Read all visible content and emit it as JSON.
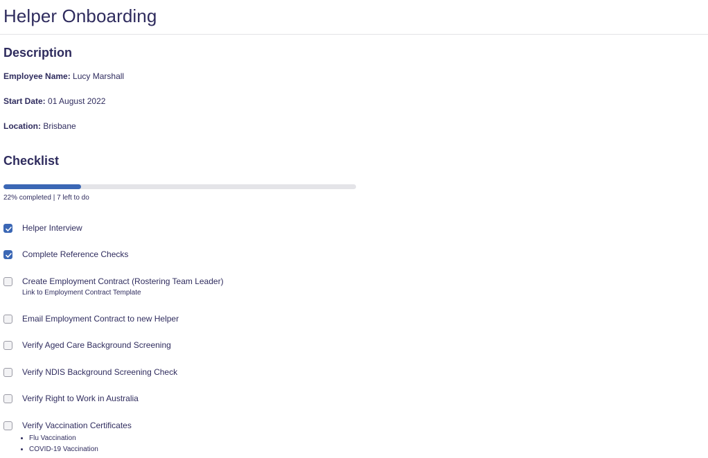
{
  "header": {
    "title": "Helper Onboarding"
  },
  "description": {
    "title": "Description",
    "fields": [
      {
        "label": "Employee Name:",
        "value": "Lucy Marshall"
      },
      {
        "label": "Start Date:",
        "value": "01 August 2022"
      },
      {
        "label": "Location:",
        "value": "Brisbane"
      }
    ]
  },
  "checklist": {
    "title": "Checklist",
    "progress_fraction": 0.22,
    "progress_text": "22% completed | 7 left to do",
    "accent_color": "#3b67b5",
    "items": [
      {
        "label": "Helper Interview",
        "checked": true
      },
      {
        "label": "Complete Reference Checks",
        "checked": true
      },
      {
        "label": "Create Employment Contract (Rostering Team Leader)",
        "checked": false,
        "note": "Link to Employment Contract Template"
      },
      {
        "label": "Email Employment Contract to new Helper",
        "checked": false
      },
      {
        "label": "Verify Aged Care Background Screening",
        "checked": false
      },
      {
        "label": "Verify NDIS Background Screening Check",
        "checked": false
      },
      {
        "label": "Verify Right to Work in Australia",
        "checked": false
      },
      {
        "label": "Verify Vaccination Certificates",
        "checked": false,
        "subitems": [
          "Flu Vaccination",
          "COVID-19 Vaccination"
        ]
      }
    ]
  }
}
